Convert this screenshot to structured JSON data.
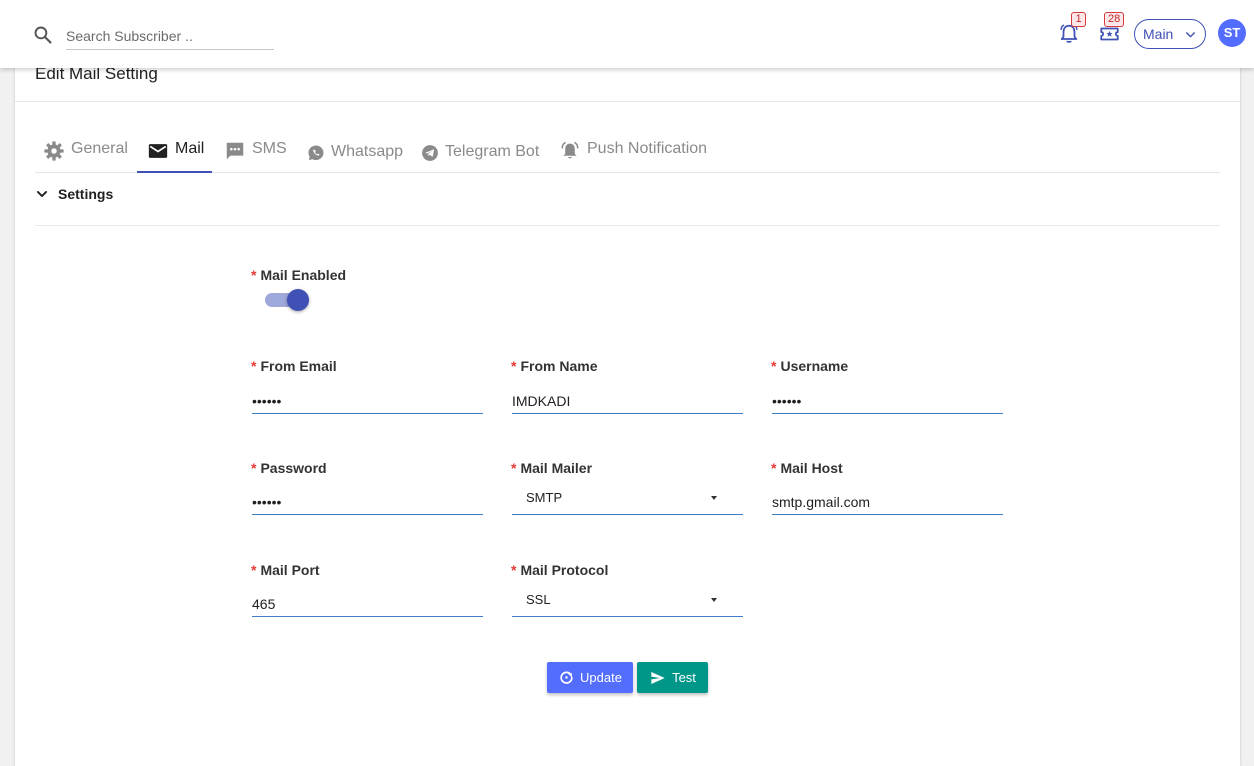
{
  "search": {
    "placeholder": "Search Subscriber .."
  },
  "notifications": {
    "badge_count": "1"
  },
  "tickets": {
    "badge_count": "28"
  },
  "workspace": {
    "selected": "Main"
  },
  "user": {
    "initials": "ST"
  },
  "page": {
    "title": "Edit Mail Setting"
  },
  "tabs": [
    {
      "label": "General",
      "icon": "gear-icon"
    },
    {
      "label": "Mail",
      "icon": "envelope-icon"
    },
    {
      "label": "SMS",
      "icon": "sms-icon"
    },
    {
      "label": "Whatsapp",
      "icon": "whatsapp-icon"
    },
    {
      "label": "Telegram Bot",
      "icon": "telegram-icon"
    },
    {
      "label": "Push Notification",
      "icon": "bell-ring-icon"
    }
  ],
  "active_tab": "Mail",
  "section": {
    "title": "Settings"
  },
  "form": {
    "mail_enabled": {
      "label": "Mail Enabled",
      "value": true
    },
    "from_email": {
      "label": "From Email",
      "value": "••••••"
    },
    "from_name": {
      "label": "From Name",
      "value": "IMDKADI"
    },
    "username": {
      "label": "Username",
      "value": "••••••"
    },
    "password": {
      "label": "Password",
      "value": "••••••"
    },
    "mail_mailer": {
      "label": "Mail Mailer",
      "value": "SMTP"
    },
    "mail_host": {
      "label": "Mail Host",
      "value": "smtp.gmail.com"
    },
    "mail_port": {
      "label": "Mail Port",
      "value": "465"
    },
    "mail_protocol": {
      "label": "Mail Protocol",
      "value": "SSL"
    },
    "required_marker": "*"
  },
  "actions": {
    "update_label": "Update",
    "test_label": "Test"
  },
  "colors": {
    "primary": "#3f51b5",
    "update_button": "#536dfe",
    "test_button": "#009688",
    "required": "#e53935",
    "badge_border": "#d83b3b"
  }
}
